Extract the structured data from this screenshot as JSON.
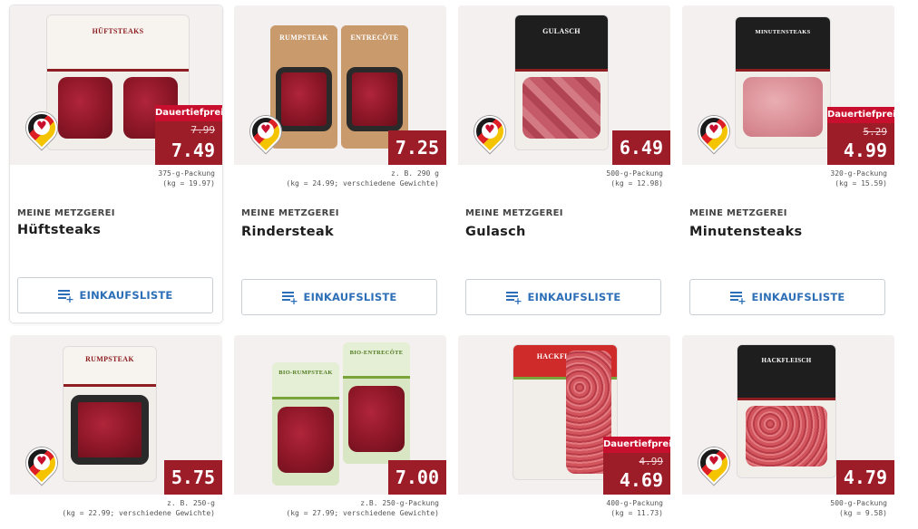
{
  "colors": {
    "price_bg": "#9c1c28",
    "dauertiefpreis_bg": "#c8102e",
    "button_text": "#2d6fb6",
    "image_bg": "#f5f0f0"
  },
  "shopping_list_label": "EINKAUFSLISTE",
  "products": [
    {
      "brand": "MEINE METZGEREI",
      "title": "Hüftsteaks",
      "pack_label": "HÜFTSTEAKS",
      "badge": "Dauertiefpreis",
      "old_price": "7.99",
      "price": "7.49",
      "pack_line1": "375-g-Packung",
      "pack_line2": "(kg = 19.97)",
      "origin_icon": "germany-origin-icon"
    },
    {
      "brand": "MEINE METZGEREI",
      "title": "Rindersteak",
      "pack_label": "RUMPSTEAK",
      "pack_label2": "ENTRECÔTE",
      "price": "7.25",
      "pack_line1": "z. B. 290 g",
      "pack_line2": "(kg = 24.99; verschiedene Gewichte)",
      "origin_icon": "germany-origin-icon"
    },
    {
      "brand": "MEINE METZGEREI",
      "title": "Gulasch",
      "pack_label": "GULASCH",
      "price": "6.49",
      "pack_line1": "500-g-Packung",
      "pack_line2": "(kg = 12.98)",
      "origin_icon": "germany-origin-icon"
    },
    {
      "brand": "MEINE METZGEREI",
      "title": "Minutensteaks",
      "pack_label": "MINUTENSTEAKS",
      "badge": "Dauertiefpreis",
      "old_price": "5.29",
      "price": "4.99",
      "pack_line1": "320-g-Packung",
      "pack_line2": "(kg = 15.59)",
      "origin_icon": "germany-origin-icon"
    },
    {
      "pack_label": "RUMPSTEAK",
      "price": "5.75",
      "pack_line1": "z. B. 250-g",
      "pack_line2": "(kg = 22.99; verschiedene Gewichte)",
      "origin_icon": "germany-origin-icon"
    },
    {
      "pack_label": "BIO-RUMPSTEAK",
      "pack_label2": "BIO-ENTRECÔTE",
      "price": "7.00",
      "pack_line1": "z.B. 250-g-Packung",
      "pack_line2": "(kg = 27.99; verschiedene Gewichte)"
    },
    {
      "pack_label": "HACKFLEISCH",
      "badge": "Dauertiefpreis",
      "old_price": "4.99",
      "price": "4.69",
      "pack_line1": "400-g-Packung",
      "pack_line2": "(kg = 11.73)"
    },
    {
      "pack_label": "HACKFLEISCH",
      "price": "4.79",
      "pack_line1": "500-g-Packung",
      "pack_line2": "(kg = 9.58)",
      "origin_icon": "germany-origin-icon"
    }
  ]
}
